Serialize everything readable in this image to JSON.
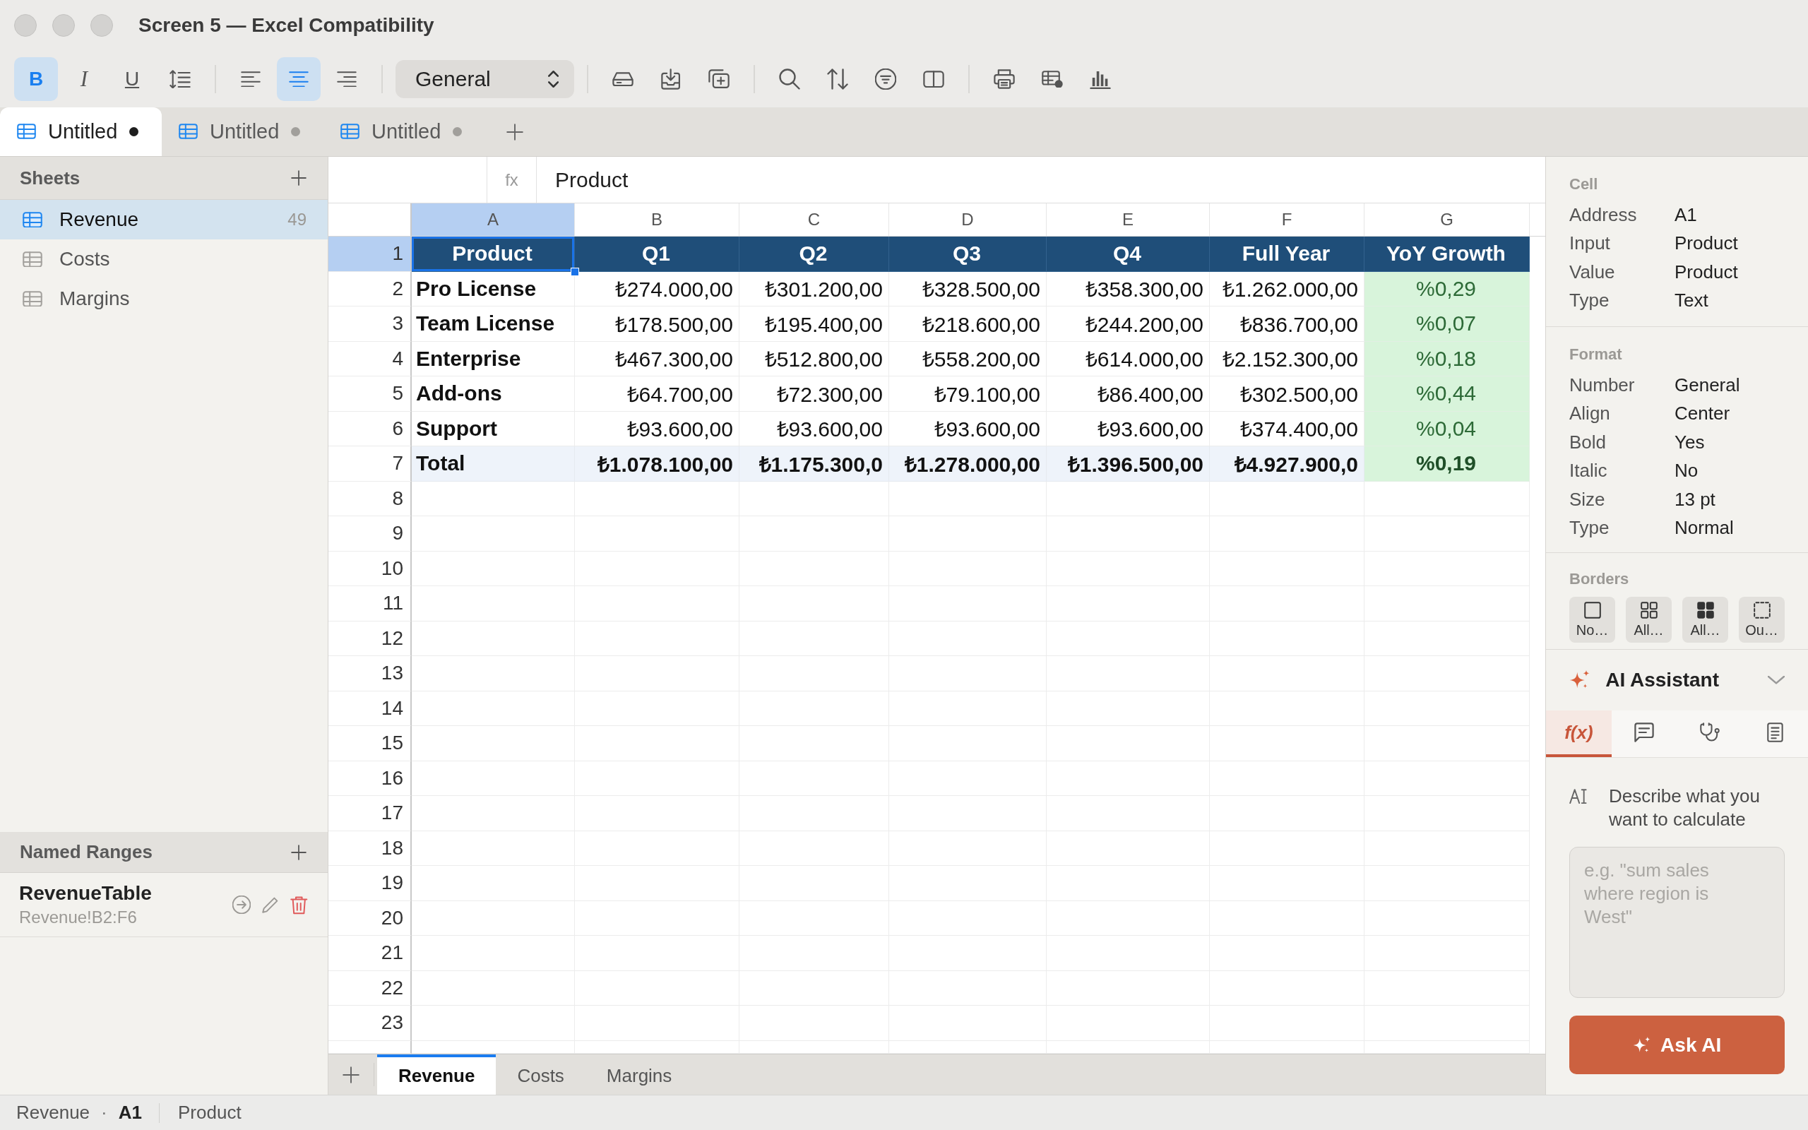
{
  "window": {
    "title": "Screen 5 — Excel Compatibility"
  },
  "toolbar": {
    "text_style": [
      {
        "label": "B",
        "kind": "bold",
        "selected": true
      },
      {
        "label": "I",
        "kind": "italic",
        "selected": false
      },
      {
        "label": "U",
        "kind": "underline",
        "selected": false
      }
    ],
    "alignment": [
      {
        "selected": false
      },
      {
        "selected": true
      },
      {
        "selected": false
      }
    ],
    "number_format": {
      "value": "General"
    }
  },
  "tabs": [
    {
      "label": "Untitled",
      "selected": true
    },
    {
      "label": "Untitled",
      "selected": false
    },
    {
      "label": "Untitled",
      "selected": false
    }
  ],
  "sidebar": {
    "sheets_title": "Sheets",
    "sheets": [
      {
        "label": "Revenue",
        "count": "49",
        "selected": true
      },
      {
        "label": "Costs",
        "selected": false
      },
      {
        "label": "Margins",
        "selected": false
      }
    ],
    "named_ranges_title": "Named Ranges",
    "named_ranges": [
      {
        "name": "RevenueTable",
        "range": "Revenue!B2:F6"
      }
    ]
  },
  "formula_bar": {
    "label": "fx",
    "value": "Product"
  },
  "grid": {
    "columns": [
      {
        "label": "A",
        "kind": "label",
        "selected": true
      },
      {
        "label": "B",
        "kind": "amount",
        "selected": false
      },
      {
        "label": "C",
        "kind": "amount",
        "selected": false
      },
      {
        "label": "D",
        "kind": "amount",
        "selected": false
      },
      {
        "label": "E",
        "kind": "amount",
        "selected": false
      },
      {
        "label": "F",
        "kind": "amount",
        "selected": false
      },
      {
        "label": "G",
        "kind": "growth",
        "selected": false
      }
    ],
    "rows": [
      {
        "number": "1",
        "kind": "header",
        "selected": true,
        "cells": [
          "Product",
          "Q1",
          "Q2",
          "Q3",
          "Q4",
          "Full Year",
          "YoY Growth"
        ]
      },
      {
        "number": "2",
        "kind": "data",
        "selected": false,
        "cells": [
          "Pro License",
          "₺274.000,00",
          "₺301.200,00",
          "₺328.500,00",
          "₺358.300,00",
          "₺1.262.000,00",
          "%0,29"
        ]
      },
      {
        "number": "3",
        "kind": "data",
        "selected": false,
        "cells": [
          "Team License",
          "₺178.500,00",
          "₺195.400,00",
          "₺218.600,00",
          "₺244.200,00",
          "₺836.700,00",
          "%0,07"
        ]
      },
      {
        "number": "4",
        "kind": "data",
        "selected": false,
        "cells": [
          "Enterprise",
          "₺467.300,00",
          "₺512.800,00",
          "₺558.200,00",
          "₺614.000,00",
          "₺2.152.300,00",
          "%0,18"
        ]
      },
      {
        "number": "5",
        "kind": "data",
        "selected": false,
        "cells": [
          "Add-ons",
          "₺64.700,00",
          "₺72.300,00",
          "₺79.100,00",
          "₺86.400,00",
          "₺302.500,00",
          "%0,44"
        ]
      },
      {
        "number": "6",
        "kind": "data",
        "selected": false,
        "cells": [
          "Support",
          "₺93.600,00",
          "₺93.600,00",
          "₺93.600,00",
          "₺93.600,00",
          "₺374.400,00",
          "%0,04"
        ]
      },
      {
        "number": "7",
        "kind": "total",
        "selected": false,
        "cells": [
          "Total",
          "₺1.078.100,00",
          "₺1.175.300,0",
          "₺1.278.000,00",
          "₺1.396.500,00",
          "₺4.927.900,0",
          "%0,19"
        ]
      },
      {
        "number": "8",
        "kind": "blank",
        "selected": false
      },
      {
        "number": "9",
        "kind": "blank",
        "selected": false
      },
      {
        "number": "10",
        "kind": "blank",
        "selected": false
      },
      {
        "number": "11",
        "kind": "blank",
        "selected": false
      },
      {
        "number": "12",
        "kind": "blank",
        "selected": false
      },
      {
        "number": "13",
        "kind": "blank",
        "selected": false
      },
      {
        "number": "14",
        "kind": "blank",
        "selected": false
      },
      {
        "number": "15",
        "kind": "blank",
        "selected": false
      },
      {
        "number": "16",
        "kind": "blank",
        "selected": false
      },
      {
        "number": "17",
        "kind": "blank",
        "selected": false
      },
      {
        "number": "18",
        "kind": "blank",
        "selected": false
      },
      {
        "number": "19",
        "kind": "blank",
        "selected": false
      },
      {
        "number": "20",
        "kind": "blank",
        "selected": false
      },
      {
        "number": "21",
        "kind": "blank",
        "selected": false
      },
      {
        "number": "22",
        "kind": "blank",
        "selected": false
      },
      {
        "number": "23",
        "kind": "blank",
        "selected": false
      }
    ]
  },
  "sheet_tabs": [
    {
      "label": "Revenue",
      "selected": true
    },
    {
      "label": "Costs",
      "selected": false
    },
    {
      "label": "Margins",
      "selected": false
    }
  ],
  "inspector": {
    "cell": {
      "title": "Cell",
      "rows": [
        {
          "label": "Address",
          "value": "A1"
        },
        {
          "label": "Input",
          "value": "Product"
        },
        {
          "label": "Value",
          "value": "Product"
        },
        {
          "label": "Type",
          "value": "Text"
        }
      ]
    },
    "format": {
      "title": "Format",
      "rows": [
        {
          "label": "Number",
          "value": "General"
        },
        {
          "label": "Align",
          "value": "Center"
        },
        {
          "label": "Bold",
          "value": "Yes"
        },
        {
          "label": "Italic",
          "value": "No"
        },
        {
          "label": "Size",
          "value": "13 pt"
        },
        {
          "label": "Type",
          "value": "Normal"
        }
      ]
    },
    "borders": {
      "title": "Borders",
      "options": [
        {
          "label": "No…"
        },
        {
          "label": "All…"
        },
        {
          "label": "All…"
        },
        {
          "label": "Ou…"
        }
      ]
    }
  },
  "ai_assistant": {
    "title": "AI Assistant",
    "tabs": [
      {
        "label": "f(x)",
        "selected": true
      },
      {
        "selected": false
      },
      {
        "selected": false
      },
      {
        "selected": false
      }
    ],
    "prompt": "Describe what you want to calculate",
    "input": {
      "placeholder": "e.g. \"sum sales where region is West\""
    },
    "button": "Ask AI"
  },
  "status_bar": {
    "sheet": "Revenue",
    "separator": "·",
    "cell": "A1",
    "value": "Product"
  }
}
